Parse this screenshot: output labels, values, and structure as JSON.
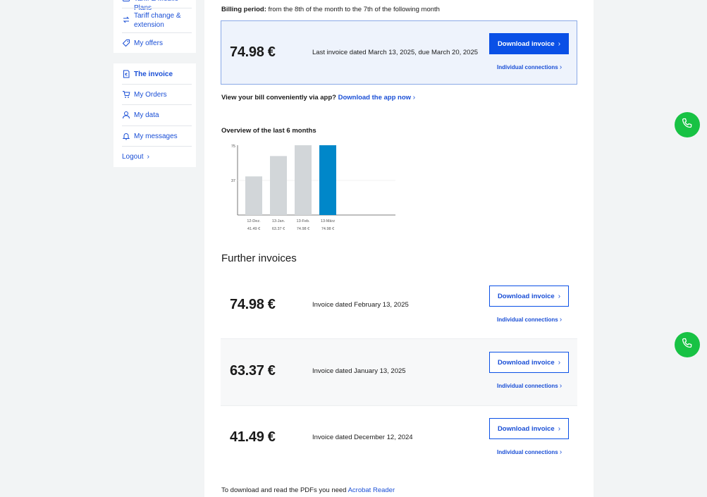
{
  "sidebar": {
    "top_items": [
      {
        "label": "Tariff & Mobile Plans",
        "icon": "card-icon"
      },
      {
        "label": "Tariff change & extension",
        "icon": "exchange-icon"
      },
      {
        "label": "My offers",
        "icon": "tag-icon"
      }
    ],
    "bottom_items": [
      {
        "label": "The invoice",
        "icon": "invoice-icon",
        "active": true
      },
      {
        "label": "My Orders",
        "icon": "cart-icon"
      },
      {
        "label": "My data",
        "icon": "user-icon"
      },
      {
        "label": "My messages",
        "icon": "bell-icon"
      }
    ],
    "logout": "Logout"
  },
  "billing": {
    "label": "Billing period:",
    "text": "from the 8th of the month to the 7th of the following month"
  },
  "current_invoice": {
    "amount": "74.98 €",
    "text": "Last invoice dated March 13, 2025, due March 20, 2025",
    "download_label": "Download invoice",
    "connections_label": "Individual connections"
  },
  "app_promo": {
    "text": "View your bill conveniently via app?",
    "link": "Download the app now"
  },
  "chart_title": "Overview of the last 6 months",
  "chart_data": {
    "type": "bar",
    "categories": [
      "12-Dez.",
      "13-Jan.",
      "13-Feb.",
      "13-März"
    ],
    "values": [
      41.49,
      63.37,
      74.98,
      74.98
    ],
    "value_labels": [
      "41.49 €",
      "63.37 €",
      "74.98 €",
      "74.98 €"
    ],
    "yticks": [
      "75",
      "37"
    ],
    "ylim": [
      0,
      75
    ],
    "colors": [
      "#d2d6d9",
      "#d2d6d9",
      "#d2d6d9",
      "#0087c9"
    ]
  },
  "further_title": "Further invoices",
  "invoices": [
    {
      "amount": "74.98 €",
      "text": "Invoice dated February 13, 2025",
      "download_label": "Download invoice",
      "connections_label": "Individual connections"
    },
    {
      "amount": "63.37 €",
      "text": "Invoice dated January 13, 2025",
      "download_label": "Download invoice",
      "connections_label": "Individual connections"
    },
    {
      "amount": "41.49 €",
      "text": "Invoice dated December 12, 2024",
      "download_label": "Download invoice",
      "connections_label": "Individual connections"
    }
  ],
  "footer": {
    "text": "To download and read the PDFs you need",
    "link": "Acrobat Reader"
  },
  "colors": {
    "accent": "#0a50e6",
    "call": "#18c244",
    "bar_active": "#0087c9",
    "bar_inactive": "#d2d6d9"
  }
}
